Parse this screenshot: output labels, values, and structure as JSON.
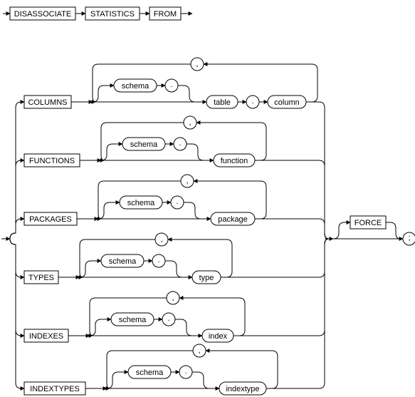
{
  "header": {
    "k1": "DISASSOCIATE",
    "k2": "STATISTICS",
    "k3": "FROM"
  },
  "branches": {
    "columns": {
      "keyword": "COLUMNS",
      "schema": "schema",
      "sep": ".",
      "item1": "table",
      "dot": ".",
      "item2": "column",
      "loop": ","
    },
    "functions": {
      "keyword": "FUNCTIONS",
      "schema": "schema",
      "sep": ".",
      "item": "function",
      "loop": ","
    },
    "packages": {
      "keyword": "PACKAGES",
      "schema": "schema",
      "sep": ".",
      "item": "package",
      "loop": ","
    },
    "types": {
      "keyword": "TYPES",
      "schema": "schema",
      "sep": ".",
      "item": "type",
      "loop": ","
    },
    "indexes": {
      "keyword": "INDEXES",
      "schema": "schema",
      "sep": ".",
      "item": "index",
      "loop": ","
    },
    "indextypes": {
      "keyword": "INDEXTYPES",
      "schema": "schema",
      "sep": ".",
      "item": "indextype",
      "loop": ","
    }
  },
  "tail": {
    "force": "FORCE",
    "semi": ";"
  },
  "chart_data": {
    "type": "table",
    "description": "Railroad/syntax diagram for DISASSOCIATE STATISTICS FROM statement",
    "sequence": [
      "DISASSOCIATE",
      "STATISTICS",
      "FROM",
      "<branch>",
      "[FORCE]",
      ";"
    ],
    "branches": [
      {
        "keyword": "COLUMNS",
        "list_item": "[schema .] table . column",
        "separator": ","
      },
      {
        "keyword": "FUNCTIONS",
        "list_item": "[schema .] function",
        "separator": ","
      },
      {
        "keyword": "PACKAGES",
        "list_item": "[schema .] package",
        "separator": ","
      },
      {
        "keyword": "TYPES",
        "list_item": "[schema .] type",
        "separator": ","
      },
      {
        "keyword": "INDEXES",
        "list_item": "[schema .] index",
        "separator": ","
      },
      {
        "keyword": "INDEXTYPES",
        "list_item": "[schema .] indextype",
        "separator": ","
      }
    ]
  }
}
